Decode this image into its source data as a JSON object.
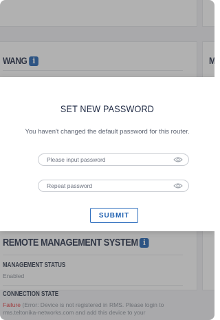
{
  "background": {
    "wan_section": {
      "title": "WANG",
      "info_icon": "info-icon",
      "right_title_letter": "M"
    },
    "rms_section": {
      "title": "REMOTE MANAGEMENT SYSTEM",
      "info_icon": "info-icon",
      "management_status_label": "MANAGEMENT STATUS",
      "management_status_value": "Enabled",
      "connection_state_label": "CONNECTION STATE",
      "connection_state_status": "Failure",
      "connection_state_detail": "(Error: Device is not registered in RMS. Please login to rms.teltonika-networks.com and add this device to your"
    }
  },
  "modal": {
    "title": "SET NEW PASSWORD",
    "message": "You haven't changed the default password for this router.",
    "password_placeholder": "Please input password",
    "repeat_placeholder": "Repeat password",
    "submit_label": "SUBMIT",
    "eye_icon": "eye-icon"
  },
  "colors": {
    "accent": "#1d5fb0",
    "failure": "#e0393e",
    "title": "#1f2a44"
  }
}
